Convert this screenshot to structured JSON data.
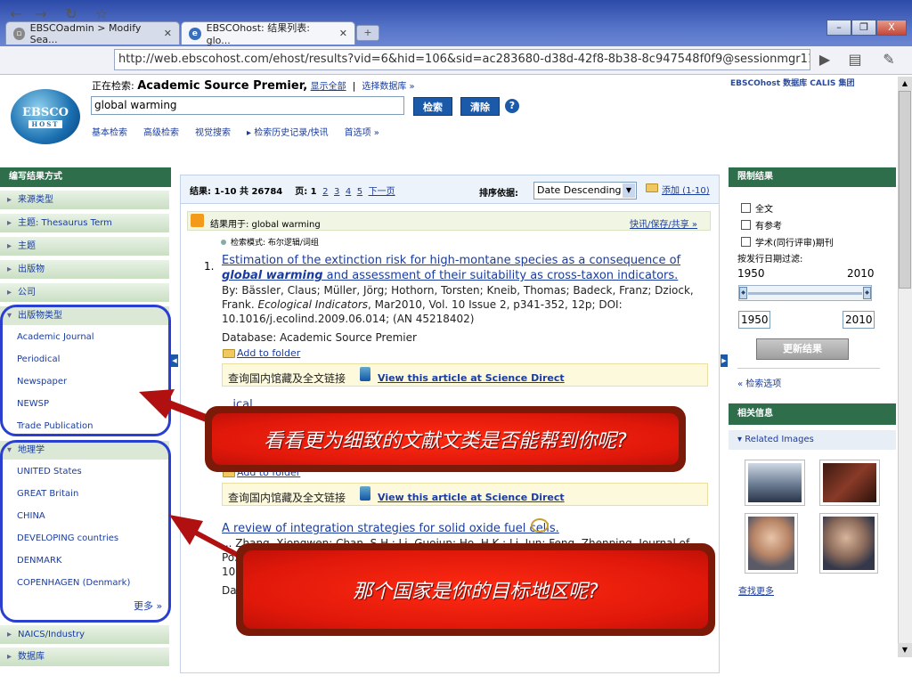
{
  "browser": {
    "tabs": [
      {
        "label": "EBSCOadmin > Modify Sea...",
        "active": false
      },
      {
        "label": "EBSCOhost: 结果列表: glo...",
        "active": true
      }
    ],
    "url": "http://web.ebscohost.com/ehost/results?vid=6&hid=106&sid=ac283680-d38d-42f8-8b38-8c947548f0f9@sessionmgr112&bc",
    "window_buttons": [
      "–",
      "❐",
      "X"
    ]
  },
  "header": {
    "logo_text": "EBSCO",
    "logo_sub": "HOST",
    "searching_label": "正在检索:",
    "database": "Academic Source Premier,",
    "show_all": "显示全部",
    "choose_db": "选择数据库 »",
    "query": "global warming",
    "search_btn": "检索",
    "clear_btn": "清除",
    "help": "?",
    "sublinks": [
      "基本检索",
      "高级检索",
      "视觉搜索",
      "▸ 检索历史记录/快讯",
      "首选项 »"
    ],
    "calis": "EBSCOhost 数据库 CALIS 集团"
  },
  "left_sidebar": {
    "title": "编写结果方式",
    "top_rows": [
      "来源类型",
      "主题: Thesaurus Term",
      "主题",
      "出版物",
      "公司"
    ],
    "pubtype_title": "出版物类型",
    "pubtypes": [
      "Academic Journal",
      "Periodical",
      "Newspaper",
      "NEWSP",
      "Trade Publication"
    ],
    "geo_title": "地理学",
    "geos": [
      "UNITED States",
      "GREAT Britain",
      "CHINA",
      "DEVELOPING countries",
      "DENMARK",
      "COPENHAGEN (Denmark)"
    ],
    "more": "更多 »",
    "bottom_rows": [
      "NAICS/Industry",
      "数据库"
    ]
  },
  "results": {
    "count_label": "结果: 1-10 共 26784",
    "page_label": "页: 1",
    "pages": [
      "2",
      "3",
      "4",
      "5",
      "下一页"
    ],
    "sort_label": "排序依据:",
    "sort_value": "Date Descending",
    "add_link": "添加 (1-10)",
    "feed_text": "结果用于: global warming",
    "feed_links": "快讯/保存/共享 »",
    "mode": "检索模式: 布尔逻辑/词组",
    "items": [
      {
        "num": "1.",
        "title_a": "Estimation of the extinction risk for high-montane species as a consequence of ",
        "title_em1": "global warming",
        "title_b": " and assessment of their suitability as cross-taxon indicators.",
        "meta1": "By: Bässler, Claus; Müller, Jörg; Hothorn, Torsten; Kneib, Thomas; Badeck, Franz; Dziock,",
        "meta2a": "Frank. ",
        "meta2_journal": "Ecological Indicators",
        "meta2b": ", Mar2010, Vol. 10 Issue 2, p341-352, 12p; DOI:",
        "meta3": "10.1016/j.ecolind.2009.06.014; (AN 45218402)",
        "database": "Database: Academic Source Premier",
        "add_folder": "Add to folder"
      },
      {
        "title_partial": "...ical...",
        "add_folder": "Add to folder"
      },
      {
        "title": "A review of integration strategies for solid oxide fuel cells.",
        "meta1": "... Zhang, Xiongwen; Chan, S.H.; Li, Guojun; Ho, H.K.; Li, Jun; Feng, Zhenping. Journal of",
        "meta2": "Po...",
        "meta3": "10...",
        "meta4": "Da..."
      }
    ],
    "library_text": "查询国内馆藏及全文链接",
    "sd_link": "View this article at Science Direct"
  },
  "right_sidebar": {
    "title": "限制结果",
    "checks": [
      "全文",
      "有参考",
      "学术(同行评审)期刊"
    ],
    "date_label": "按发行日期过滤:",
    "year_from": "1950",
    "year_to": "2010",
    "update_btn": "更新结果",
    "search_options": "« 检索选项",
    "related_title": "相关信息",
    "related_images": "▾ Related Images",
    "find_more": "查找更多"
  },
  "callouts": {
    "top": "看看更为细致的文献文类是否能帮到你呢?",
    "bottom": "那个国家是你的目标地区呢?"
  },
  "colors": {
    "accent_green": "#2f6e4b",
    "link_blue": "#1a3c9e",
    "oval_blue": "#2a3fd0",
    "callout_red": "#e0180a",
    "arrow_red": "#b01010"
  }
}
